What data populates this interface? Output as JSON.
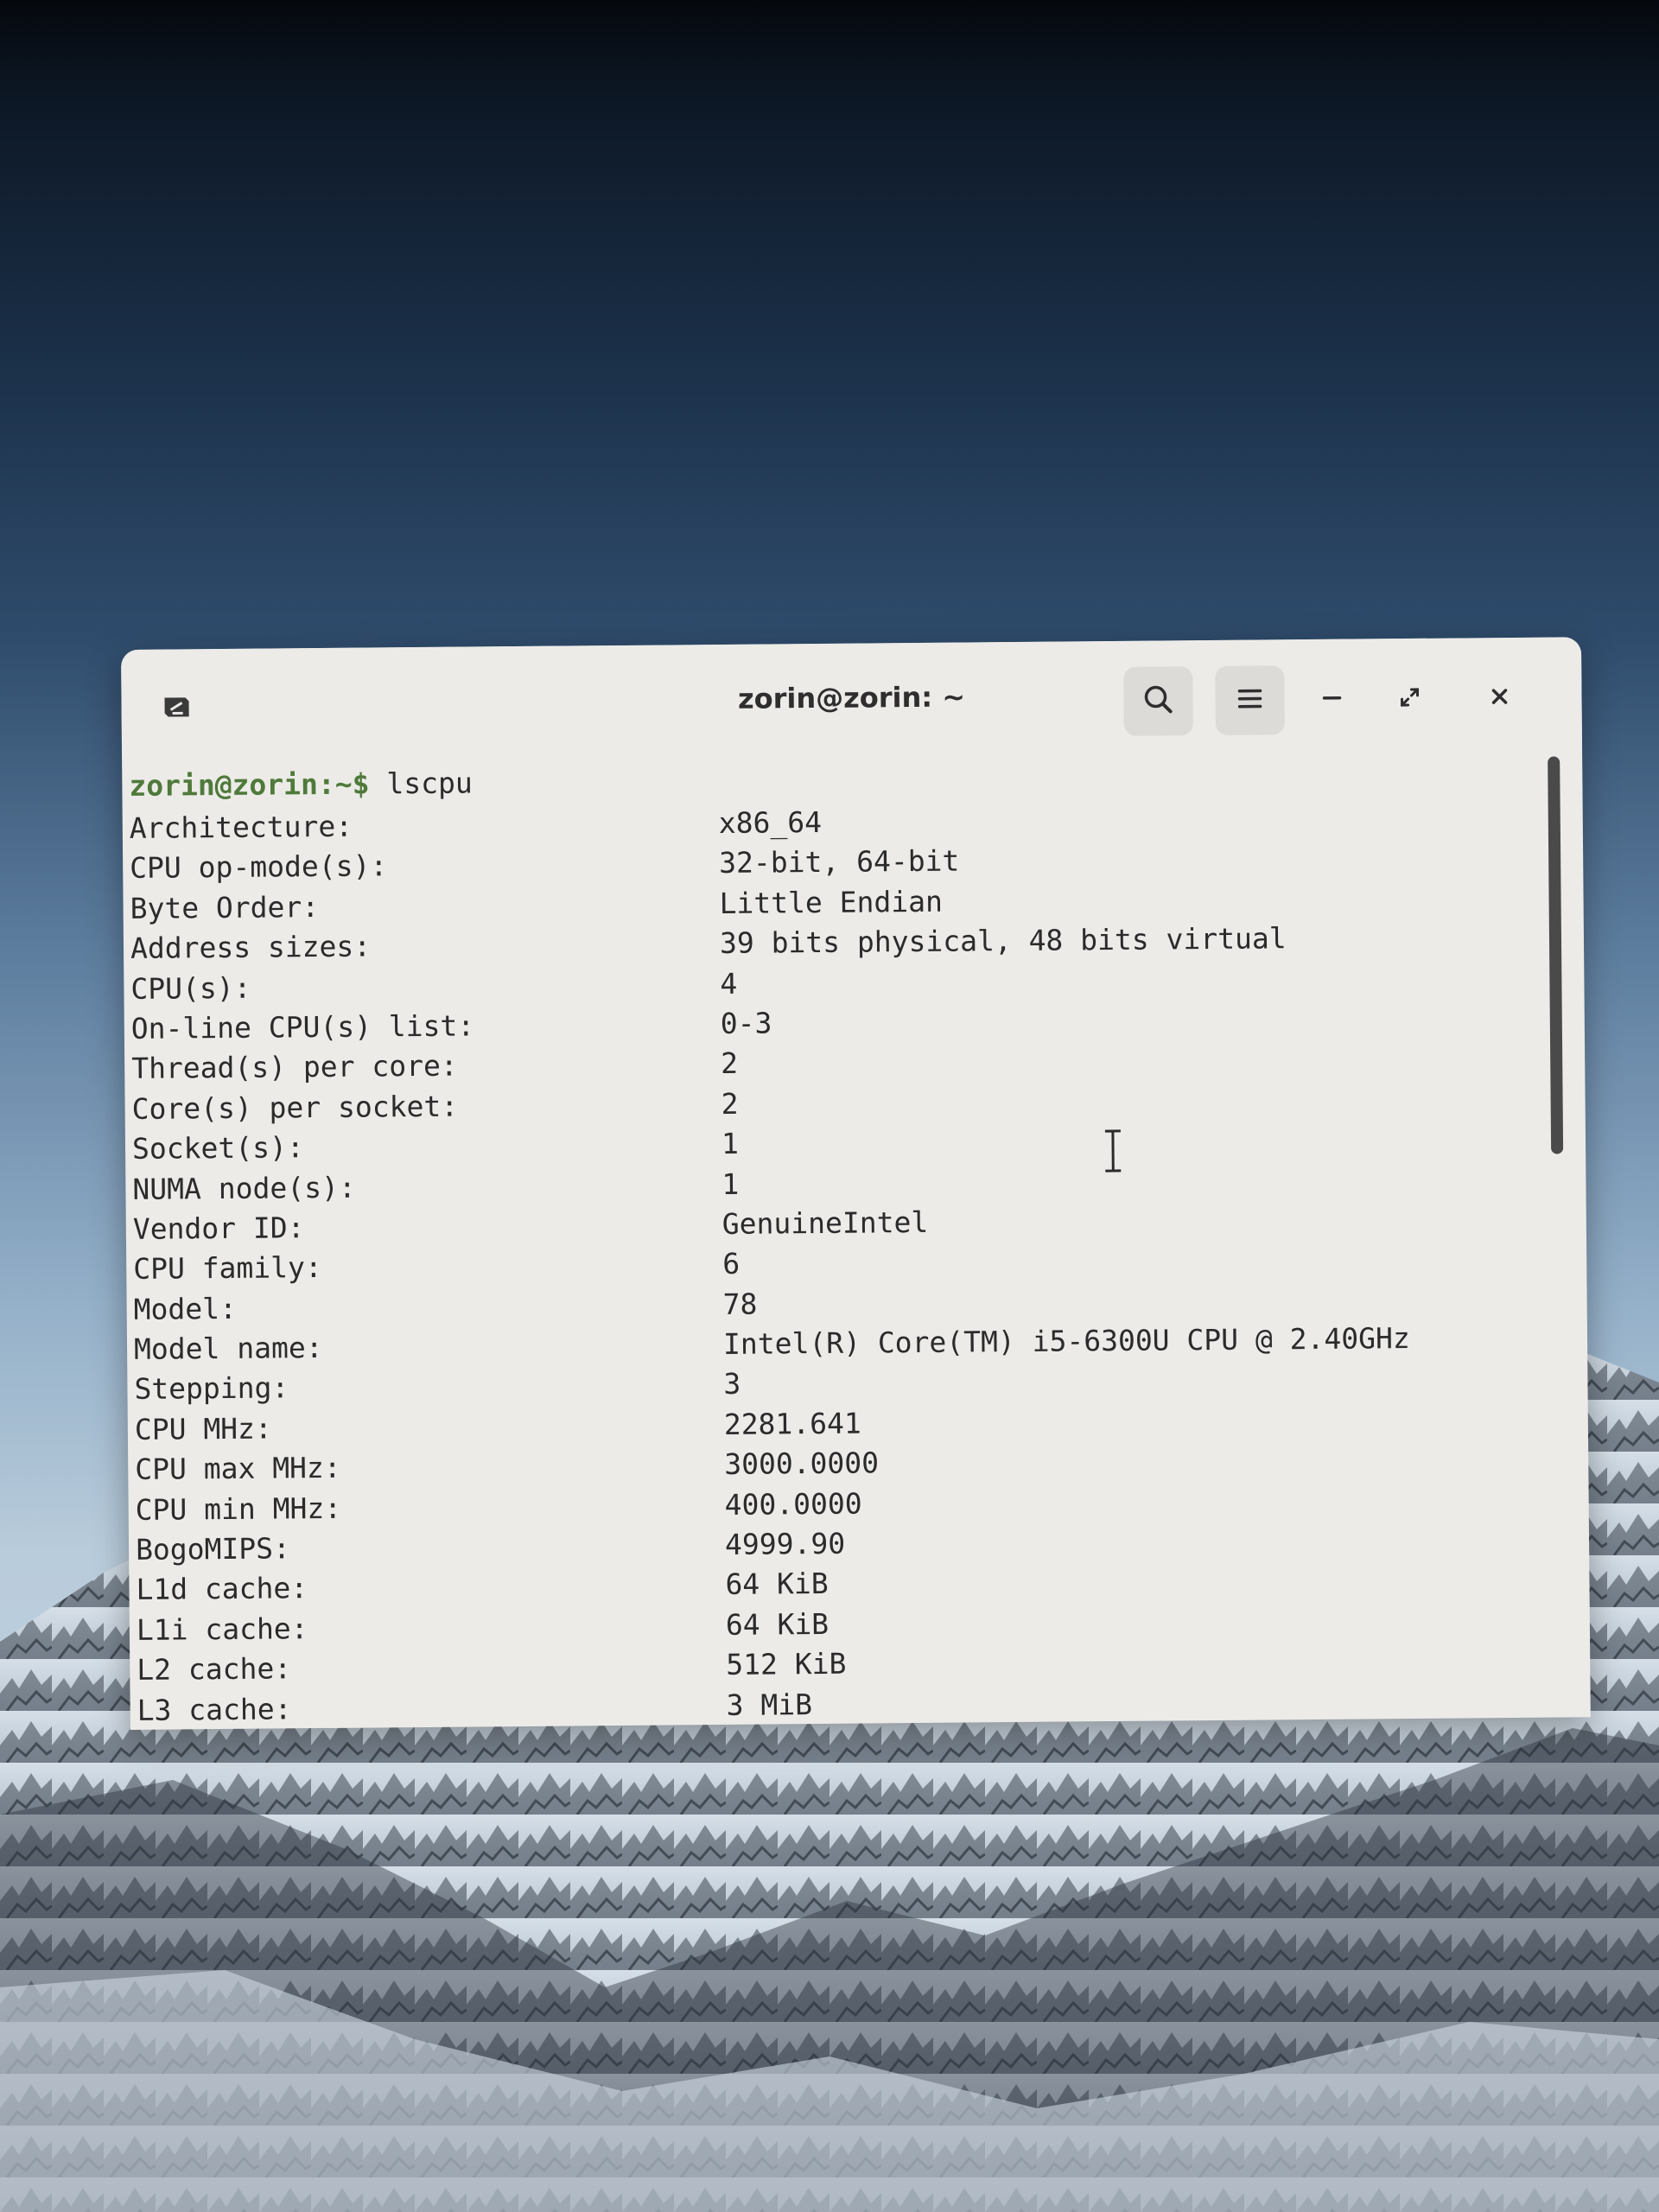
{
  "window": {
    "title": "zorin@zorin: ~"
  },
  "titlebar": {
    "buttons": [
      "new-tab-icon",
      "search-icon",
      "hamburger-menu-icon",
      "minimize-icon",
      "maximize-icon",
      "close-icon"
    ]
  },
  "terminal": {
    "prompt": "zorin@zorin:~$",
    "command": " lscpu",
    "rows": [
      {
        "label": "Architecture:",
        "value": "x86_64"
      },
      {
        "label": "CPU op-mode(s):",
        "value": "32-bit, 64-bit"
      },
      {
        "label": "Byte Order:",
        "value": "Little Endian"
      },
      {
        "label": "Address sizes:",
        "value": "39 bits physical, 48 bits virtual"
      },
      {
        "label": "CPU(s):",
        "value": "4"
      },
      {
        "label": "On-line CPU(s) list:",
        "value": "0-3"
      },
      {
        "label": "Thread(s) per core:",
        "value": "2"
      },
      {
        "label": "Core(s) per socket:",
        "value": "2"
      },
      {
        "label": "Socket(s):",
        "value": "1"
      },
      {
        "label": "NUMA node(s):",
        "value": "1"
      },
      {
        "label": "Vendor ID:",
        "value": "GenuineIntel"
      },
      {
        "label": "CPU family:",
        "value": "6"
      },
      {
        "label": "Model:",
        "value": "78"
      },
      {
        "label": "Model name:",
        "value": "Intel(R) Core(TM) i5-6300U CPU @ 2.40GHz"
      },
      {
        "label": "Stepping:",
        "value": "3"
      },
      {
        "label": "CPU MHz:",
        "value": "2281.641"
      },
      {
        "label": "CPU max MHz:",
        "value": "3000.0000"
      },
      {
        "label": "CPU min MHz:",
        "value": "400.0000"
      },
      {
        "label": "BogoMIPS:",
        "value": "4999.90"
      },
      {
        "label": "L1d cache:",
        "value": "64 KiB"
      },
      {
        "label": "L1i cache:",
        "value": "64 KiB"
      },
      {
        "label": "L2 cache:",
        "value": "512 KiB"
      },
      {
        "label": "L3 cache:",
        "value": "3 MiB"
      }
    ]
  },
  "colors": {
    "prompt": "#4f7a3a",
    "terminal_bg": "#ecebe8",
    "text": "#2b2b2b"
  }
}
